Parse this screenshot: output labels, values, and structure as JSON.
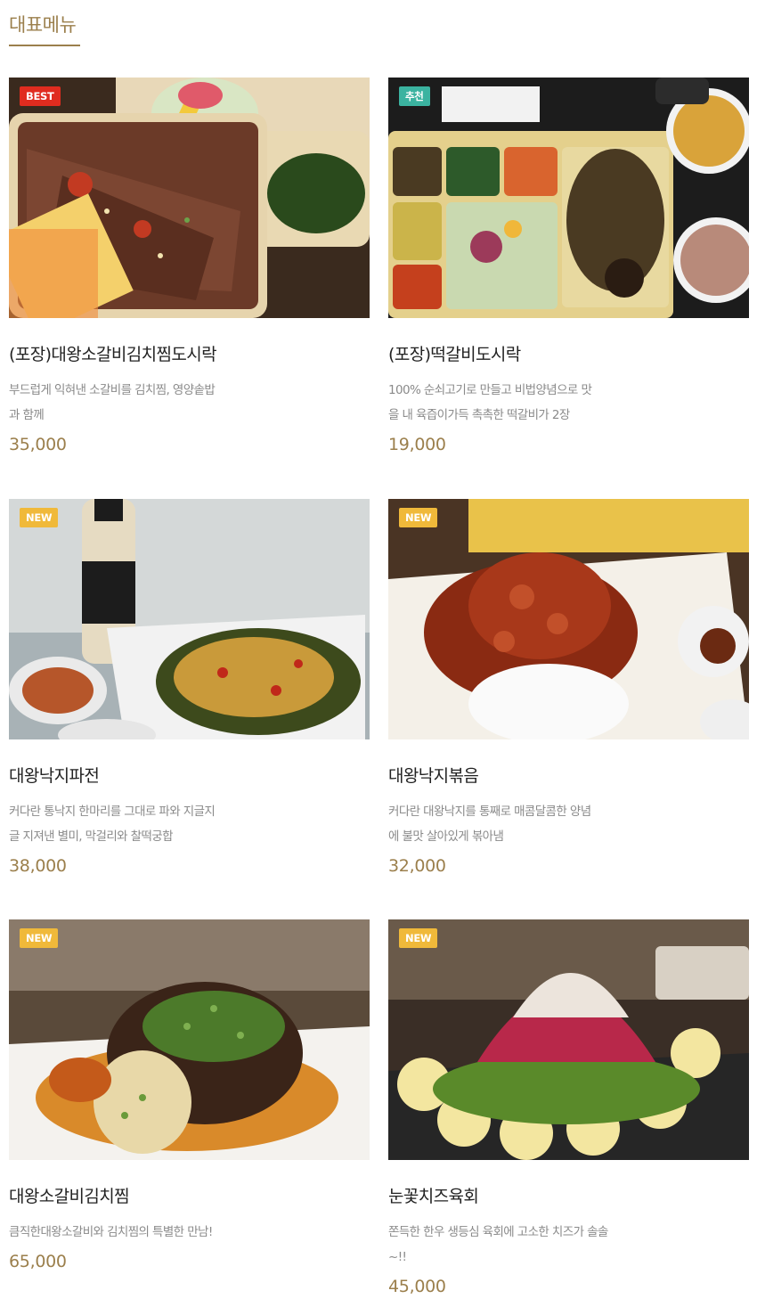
{
  "section": {
    "title": "대표메뉴"
  },
  "colors": {
    "accent": "#9b7f4c",
    "best": "#e02c1f",
    "new": "#f0b93a",
    "recommend": "#3bb3a0"
  },
  "menu": [
    {
      "badge": "BEST",
      "name": "(포장)대왕소갈비김치찜도시락",
      "desc1": "부드럽게 익혀낸 소갈비를 김치찜, 영양솥밥",
      "desc2": "과 함께",
      "price": "35,000",
      "image": "boxed-galbi-kimchi-lunch"
    },
    {
      "badge": "추천",
      "name": "(포장)떡갈비도시락",
      "desc1": "100% 순쇠고기로 만들고 비법양념으로 맛",
      "desc2": "을 내 육즙이가득 촉촉한 떡갈비가 2장",
      "price": "19,000",
      "image": "tteokgalbi-lunchbox"
    },
    {
      "badge": "NEW",
      "name": "대왕낙지파전",
      "desc1": "커다란 통낙지 한마리를 그대로 파와 지글지",
      "desc2": "글 지져낸 별미, 막걸리와 찰떡궁합",
      "price": "38,000",
      "image": "octopus-pajeon"
    },
    {
      "badge": "NEW",
      "name": "대왕낙지볶음",
      "desc1": "커다란 대왕낙지를 통째로 매콤달콤한 양념",
      "desc2": "에 불맛 살아있게 볶아냄",
      "price": "32,000",
      "image": "stir-fried-octopus"
    },
    {
      "badge": "NEW",
      "name": "대왕소갈비김치찜",
      "desc1": "큼직한대왕소갈비와 김치찜의 특별한 만남!",
      "desc2": "",
      "price": "65,000",
      "image": "galbi-kimchi-jjim"
    },
    {
      "badge": "NEW",
      "name": "눈꽃치즈육회",
      "desc1": "쫀득한 한우 생등심 육회에 고소한 치즈가 솔솔",
      "desc2": "~!!",
      "price": "45,000",
      "image": "snowflake-cheese-yukhoe"
    }
  ]
}
